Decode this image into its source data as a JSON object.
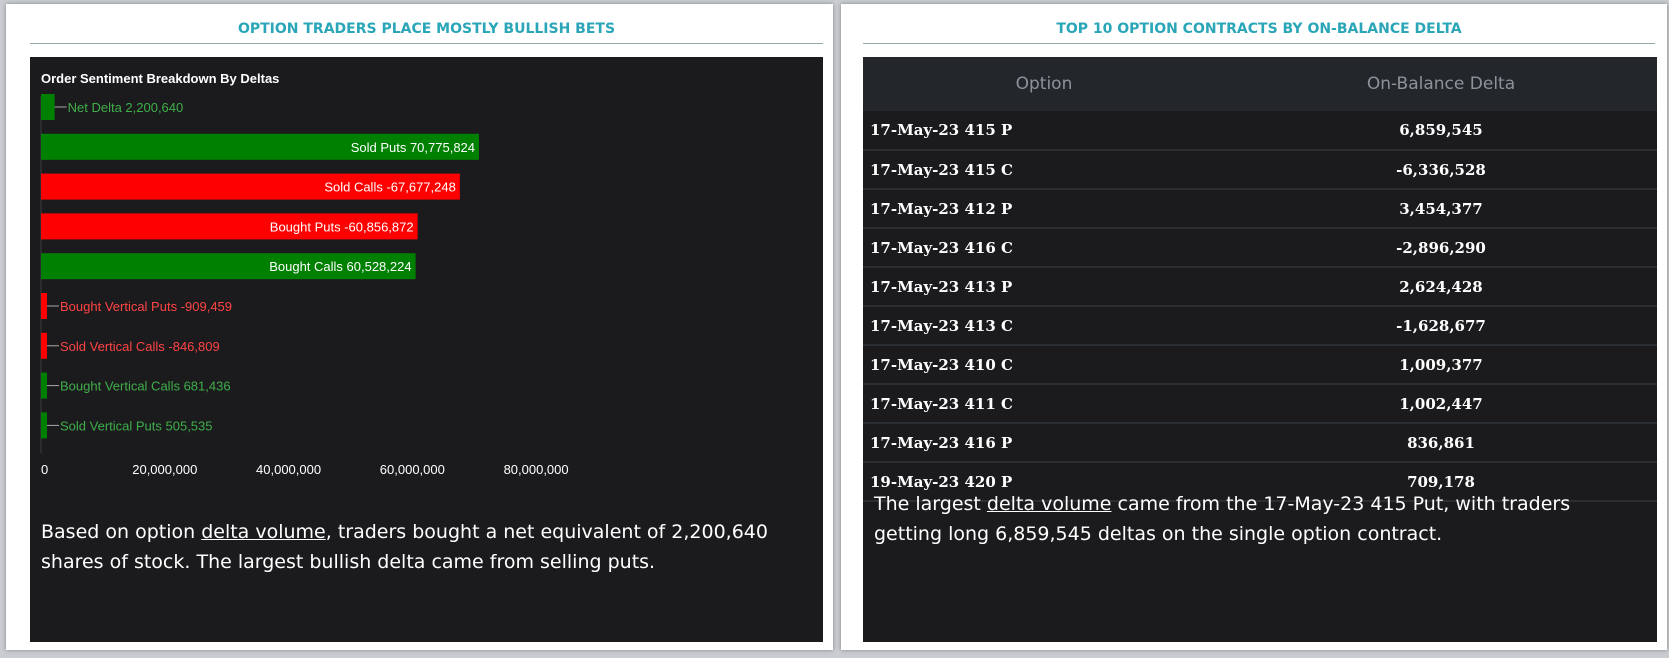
{
  "left_panel": {
    "title": "OPTION TRADERS PLACE MOSTLY BULLISH BETS",
    "chart_title": "Order Sentiment Breakdown By Deltas",
    "summary": {
      "before": "Based on option ",
      "link": "delta volume",
      "after": ", traders bought a net equivalent of 2,200,640 shares of stock. The largest bullish delta came from selling puts."
    }
  },
  "right_panel": {
    "title": "TOP 10 OPTION CONTRACTS BY ON-BALANCE DELTA",
    "columns": [
      "Option",
      "On-Balance Delta"
    ],
    "rows": [
      {
        "option": "17-May-23 415 P",
        "delta": "6,859,545"
      },
      {
        "option": "17-May-23 415 C",
        "delta": "-6,336,528"
      },
      {
        "option": "17-May-23 412 P",
        "delta": "3,454,377"
      },
      {
        "option": "17-May-23 416 C",
        "delta": "-2,896,290"
      },
      {
        "option": "17-May-23 413 P",
        "delta": "2,624,428"
      },
      {
        "option": "17-May-23 413 C",
        "delta": "-1,628,677"
      },
      {
        "option": "17-May-23 410 C",
        "delta": "1,009,377"
      },
      {
        "option": "17-May-23 411 C",
        "delta": "1,002,447"
      },
      {
        "option": "17-May-23 416 P",
        "delta": "836,861"
      },
      {
        "option": "19-May-23 420 P",
        "delta": "709,178"
      }
    ],
    "summary": {
      "before": "The largest ",
      "link": "delta volume",
      "after": " came from the 17-May-23 415 Put, with traders getting long 6,859,545 deltas on the single option contract."
    }
  },
  "colors": {
    "title_teal": "#2aa6b8",
    "positive": "#008000",
    "negative": "#ff0000",
    "positive_label": "#3fae49",
    "negative_label": "#ff4444"
  },
  "chart_data": {
    "type": "bar",
    "orientation": "horizontal",
    "title": "Order Sentiment Breakdown By Deltas",
    "xlim": [
      0,
      90000000
    ],
    "xticks": [
      0,
      20000000,
      40000000,
      60000000,
      80000000
    ],
    "xtick_labels": [
      "0",
      "20,000,000",
      "40,000,000",
      "60,000,000",
      "80,000,000"
    ],
    "bars": [
      {
        "label": "Net Delta 2,200,640",
        "value": 2200640,
        "sign": "positive"
      },
      {
        "label": "Sold Puts 70,775,824",
        "value": 70775824,
        "sign": "positive"
      },
      {
        "label": "Sold Calls -67,677,248",
        "value": 67677248,
        "sign": "negative"
      },
      {
        "label": "Bought Puts -60,856,872",
        "value": 60856872,
        "sign": "negative"
      },
      {
        "label": "Bought Calls 60,528,224",
        "value": 60528224,
        "sign": "positive"
      },
      {
        "label": "Bought Vertical Puts -909,459",
        "value": 909459,
        "sign": "negative"
      },
      {
        "label": "Sold Vertical Calls -846,809",
        "value": 846809,
        "sign": "negative"
      },
      {
        "label": "Bought Vertical Calls 681,436",
        "value": 681436,
        "sign": "positive"
      },
      {
        "label": "Sold Vertical Puts 505,535",
        "value": 505535,
        "sign": "positive"
      }
    ]
  }
}
